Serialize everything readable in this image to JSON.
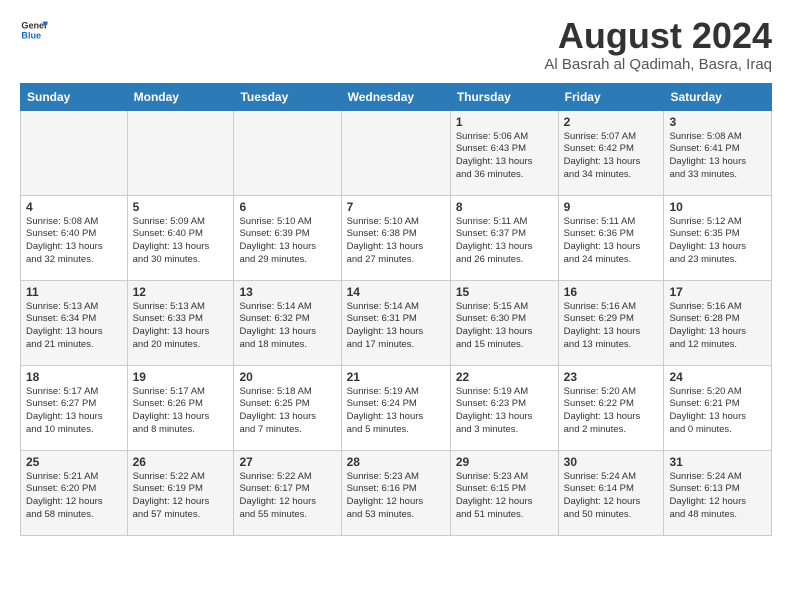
{
  "logo": {
    "line1": "General",
    "line2": "Blue"
  },
  "title": "August 2024",
  "subtitle": "Al Basrah al Qadimah, Basra, Iraq",
  "weekdays": [
    "Sunday",
    "Monday",
    "Tuesday",
    "Wednesday",
    "Thursday",
    "Friday",
    "Saturday"
  ],
  "weeks": [
    [
      {
        "day": "",
        "content": ""
      },
      {
        "day": "",
        "content": ""
      },
      {
        "day": "",
        "content": ""
      },
      {
        "day": "",
        "content": ""
      },
      {
        "day": "1",
        "content": "Sunrise: 5:06 AM\nSunset: 6:43 PM\nDaylight: 13 hours\nand 36 minutes."
      },
      {
        "day": "2",
        "content": "Sunrise: 5:07 AM\nSunset: 6:42 PM\nDaylight: 13 hours\nand 34 minutes."
      },
      {
        "day": "3",
        "content": "Sunrise: 5:08 AM\nSunset: 6:41 PM\nDaylight: 13 hours\nand 33 minutes."
      }
    ],
    [
      {
        "day": "4",
        "content": "Sunrise: 5:08 AM\nSunset: 6:40 PM\nDaylight: 13 hours\nand 32 minutes."
      },
      {
        "day": "5",
        "content": "Sunrise: 5:09 AM\nSunset: 6:40 PM\nDaylight: 13 hours\nand 30 minutes."
      },
      {
        "day": "6",
        "content": "Sunrise: 5:10 AM\nSunset: 6:39 PM\nDaylight: 13 hours\nand 29 minutes."
      },
      {
        "day": "7",
        "content": "Sunrise: 5:10 AM\nSunset: 6:38 PM\nDaylight: 13 hours\nand 27 minutes."
      },
      {
        "day": "8",
        "content": "Sunrise: 5:11 AM\nSunset: 6:37 PM\nDaylight: 13 hours\nand 26 minutes."
      },
      {
        "day": "9",
        "content": "Sunrise: 5:11 AM\nSunset: 6:36 PM\nDaylight: 13 hours\nand 24 minutes."
      },
      {
        "day": "10",
        "content": "Sunrise: 5:12 AM\nSunset: 6:35 PM\nDaylight: 13 hours\nand 23 minutes."
      }
    ],
    [
      {
        "day": "11",
        "content": "Sunrise: 5:13 AM\nSunset: 6:34 PM\nDaylight: 13 hours\nand 21 minutes."
      },
      {
        "day": "12",
        "content": "Sunrise: 5:13 AM\nSunset: 6:33 PM\nDaylight: 13 hours\nand 20 minutes."
      },
      {
        "day": "13",
        "content": "Sunrise: 5:14 AM\nSunset: 6:32 PM\nDaylight: 13 hours\nand 18 minutes."
      },
      {
        "day": "14",
        "content": "Sunrise: 5:14 AM\nSunset: 6:31 PM\nDaylight: 13 hours\nand 17 minutes."
      },
      {
        "day": "15",
        "content": "Sunrise: 5:15 AM\nSunset: 6:30 PM\nDaylight: 13 hours\nand 15 minutes."
      },
      {
        "day": "16",
        "content": "Sunrise: 5:16 AM\nSunset: 6:29 PM\nDaylight: 13 hours\nand 13 minutes."
      },
      {
        "day": "17",
        "content": "Sunrise: 5:16 AM\nSunset: 6:28 PM\nDaylight: 13 hours\nand 12 minutes."
      }
    ],
    [
      {
        "day": "18",
        "content": "Sunrise: 5:17 AM\nSunset: 6:27 PM\nDaylight: 13 hours\nand 10 minutes."
      },
      {
        "day": "19",
        "content": "Sunrise: 5:17 AM\nSunset: 6:26 PM\nDaylight: 13 hours\nand 8 minutes."
      },
      {
        "day": "20",
        "content": "Sunrise: 5:18 AM\nSunset: 6:25 PM\nDaylight: 13 hours\nand 7 minutes."
      },
      {
        "day": "21",
        "content": "Sunrise: 5:19 AM\nSunset: 6:24 PM\nDaylight: 13 hours\nand 5 minutes."
      },
      {
        "day": "22",
        "content": "Sunrise: 5:19 AM\nSunset: 6:23 PM\nDaylight: 13 hours\nand 3 minutes."
      },
      {
        "day": "23",
        "content": "Sunrise: 5:20 AM\nSunset: 6:22 PM\nDaylight: 13 hours\nand 2 minutes."
      },
      {
        "day": "24",
        "content": "Sunrise: 5:20 AM\nSunset: 6:21 PM\nDaylight: 13 hours\nand 0 minutes."
      }
    ],
    [
      {
        "day": "25",
        "content": "Sunrise: 5:21 AM\nSunset: 6:20 PM\nDaylight: 12 hours\nand 58 minutes."
      },
      {
        "day": "26",
        "content": "Sunrise: 5:22 AM\nSunset: 6:19 PM\nDaylight: 12 hours\nand 57 minutes."
      },
      {
        "day": "27",
        "content": "Sunrise: 5:22 AM\nSunset: 6:17 PM\nDaylight: 12 hours\nand 55 minutes."
      },
      {
        "day": "28",
        "content": "Sunrise: 5:23 AM\nSunset: 6:16 PM\nDaylight: 12 hours\nand 53 minutes."
      },
      {
        "day": "29",
        "content": "Sunrise: 5:23 AM\nSunset: 6:15 PM\nDaylight: 12 hours\nand 51 minutes."
      },
      {
        "day": "30",
        "content": "Sunrise: 5:24 AM\nSunset: 6:14 PM\nDaylight: 12 hours\nand 50 minutes."
      },
      {
        "day": "31",
        "content": "Sunrise: 5:24 AM\nSunset: 6:13 PM\nDaylight: 12 hours\nand 48 minutes."
      }
    ]
  ]
}
